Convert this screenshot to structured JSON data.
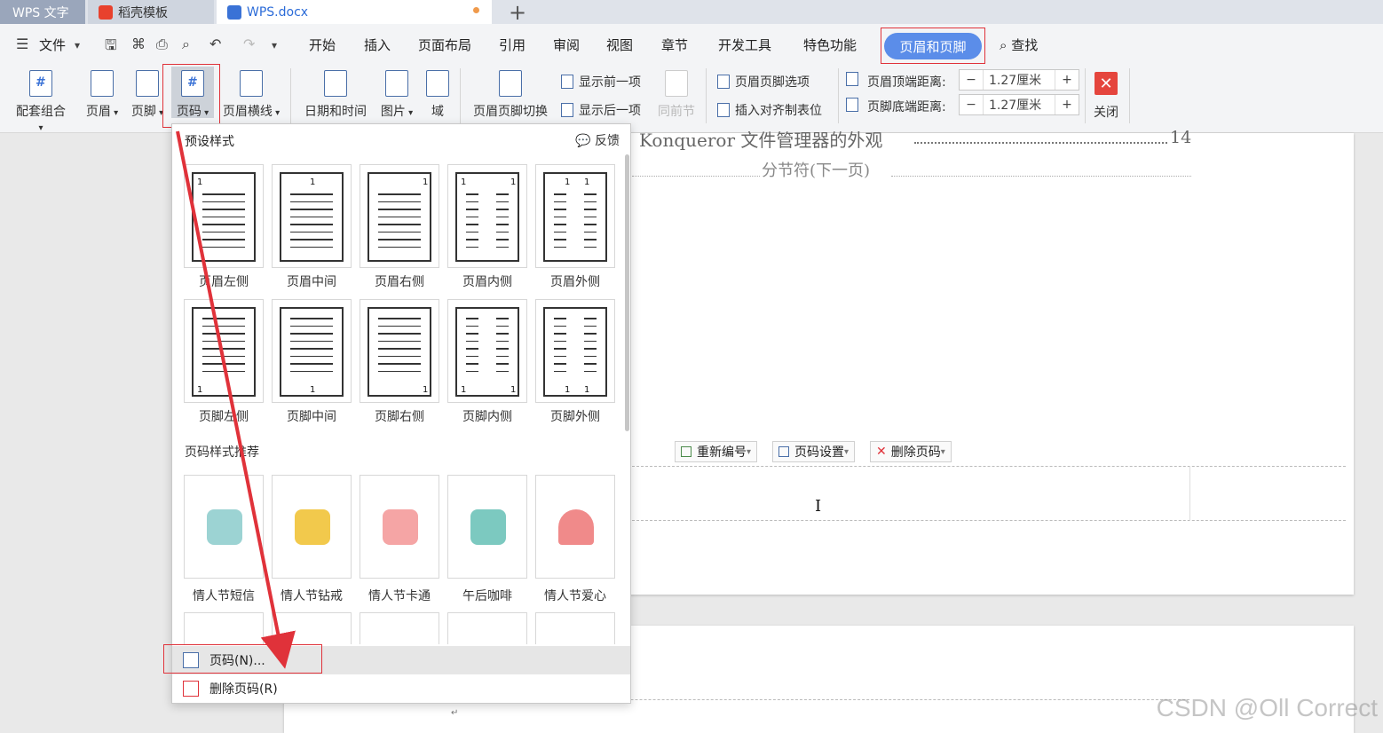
{
  "tabs": {
    "wps": "WPS 文字",
    "template": "稻壳模板",
    "doc": "WPS.docx",
    "add": "+"
  },
  "menu": {
    "file": "文件",
    "items": [
      "开始",
      "插入",
      "页面布局",
      "引用",
      "审阅",
      "视图",
      "章节",
      "开发工具",
      "特色功能"
    ],
    "active_tab": "页眉和页脚",
    "find": "查找"
  },
  "ribbon": {
    "buttons": [
      "配套组合",
      "页眉",
      "页脚",
      "页码",
      "页眉横线",
      "日期和时间",
      "图片",
      "域",
      "页眉页脚切换"
    ],
    "show_prev": "显示前一项",
    "show_next": "显示后一项",
    "same_as_prev": "同前节",
    "hf_options": "页眉页脚选项",
    "insert_tab": "插入对齐制表位",
    "header_top_label": "页眉顶端距离:",
    "header_top_value": "1.27厘米",
    "footer_bottom_label": "页脚底端距离:",
    "footer_bottom_value": "1.27厘米",
    "close": "关闭"
  },
  "document": {
    "toc_text": "Konqueror 文件管理器的外观",
    "toc_page": "14",
    "section_break": "分节符(下一页)",
    "page_tools": [
      "重新编号",
      "页码设置",
      "删除页码"
    ]
  },
  "dropdown": {
    "preset_title": "预设样式",
    "feedback": "反馈",
    "presets_row1": [
      "页眉左侧",
      "页眉中间",
      "页眉右侧",
      "页眉内侧",
      "页眉外侧"
    ],
    "presets_row2": [
      "页脚左侧",
      "页脚中间",
      "页脚右侧",
      "页脚内侧",
      "页脚外侧"
    ],
    "recommend_title": "页码样式推荐",
    "recommend": [
      "情人节短信",
      "情人节钻戒",
      "情人节卡通",
      "午后咖啡",
      "情人节爱心"
    ],
    "action_page_number": "页码(N)...",
    "action_delete": "删除页码(R)"
  },
  "watermark": "CSDN @Oll Correct",
  "colors": {
    "accent": "#5b8de9",
    "annotation": "#e0323a",
    "close": "#e5453d"
  }
}
